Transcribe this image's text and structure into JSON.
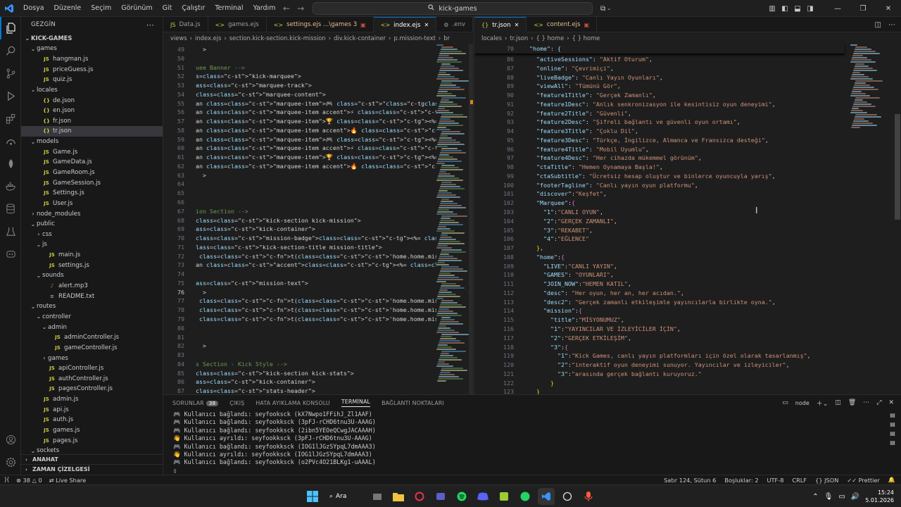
{
  "titlebar": {
    "menu": [
      "Dosya",
      "Düzenle",
      "Seçim",
      "Görünüm",
      "Git",
      "Çalıştır",
      "Terminal",
      "Yardım"
    ],
    "search": "kick-games"
  },
  "sidebar": {
    "title": "GEZGİN",
    "root": "KICK-GAMES",
    "items": [
      {
        "label": "games",
        "depth": 1,
        "type": "folder",
        "open": true
      },
      {
        "label": "hangman.js",
        "depth": 2,
        "type": "js"
      },
      {
        "label": "priceGuess.js",
        "depth": 2,
        "type": "js"
      },
      {
        "label": "quiz.js",
        "depth": 2,
        "type": "js"
      },
      {
        "label": "locales",
        "depth": 1,
        "type": "folder",
        "open": true
      },
      {
        "label": "de.json",
        "depth": 2,
        "type": "json"
      },
      {
        "label": "en.json",
        "depth": 2,
        "type": "json"
      },
      {
        "label": "fr.json",
        "depth": 2,
        "type": "json"
      },
      {
        "label": "tr.json",
        "depth": 2,
        "type": "json",
        "selected": true
      },
      {
        "label": "models",
        "depth": 1,
        "type": "folder",
        "open": true
      },
      {
        "label": "Game.js",
        "depth": 2,
        "type": "js"
      },
      {
        "label": "GameData.js",
        "depth": 2,
        "type": "js"
      },
      {
        "label": "GameRoom.js",
        "depth": 2,
        "type": "js"
      },
      {
        "label": "GameSession.js",
        "depth": 2,
        "type": "js"
      },
      {
        "label": "Settings.js",
        "depth": 2,
        "type": "js"
      },
      {
        "label": "User.js",
        "depth": 2,
        "type": "js"
      },
      {
        "label": "node_modules",
        "depth": 1,
        "type": "folder",
        "open": false
      },
      {
        "label": "public",
        "depth": 1,
        "type": "folder",
        "open": true
      },
      {
        "label": "css",
        "depth": 2,
        "type": "folder",
        "open": false
      },
      {
        "label": "js",
        "depth": 2,
        "type": "folder",
        "open": true
      },
      {
        "label": "main.js",
        "depth": 3,
        "type": "js"
      },
      {
        "label": "settings.js",
        "depth": 3,
        "type": "js"
      },
      {
        "label": "sounds",
        "depth": 2,
        "type": "folder",
        "open": true
      },
      {
        "label": "alert.mp3",
        "depth": 3,
        "type": "mp3"
      },
      {
        "label": "README.txt",
        "depth": 3,
        "type": "txt"
      },
      {
        "label": "routes",
        "depth": 1,
        "type": "folder",
        "open": true
      },
      {
        "label": "controller",
        "depth": 2,
        "type": "folder",
        "open": true
      },
      {
        "label": "admin",
        "depth": 3,
        "type": "folder",
        "open": true
      },
      {
        "label": "adminController.js",
        "depth": 4,
        "type": "js"
      },
      {
        "label": "gameController.js",
        "depth": 4,
        "type": "js"
      },
      {
        "label": "games",
        "depth": 3,
        "type": "folder",
        "open": false
      },
      {
        "label": "apiController.js",
        "depth": 3,
        "type": "js"
      },
      {
        "label": "authController.js",
        "depth": 3,
        "type": "js"
      },
      {
        "label": "pagesController.js",
        "depth": 3,
        "type": "js"
      },
      {
        "label": "admin.js",
        "depth": 2,
        "type": "js"
      },
      {
        "label": "api.js",
        "depth": 2,
        "type": "js"
      },
      {
        "label": "auth.js",
        "depth": 2,
        "type": "js"
      },
      {
        "label": "games.js",
        "depth": 2,
        "type": "js"
      },
      {
        "label": "pages.js",
        "depth": 2,
        "type": "js"
      },
      {
        "label": "sockets",
        "depth": 1,
        "type": "folder",
        "open": true
      }
    ],
    "outline": "ANAHAT",
    "timeline": "ZAMAN ÇİZELGESİ"
  },
  "editor1": {
    "tabs": [
      {
        "label": "Data.js",
        "type": "js"
      },
      {
        "label": "games.ejs",
        "type": "ejs"
      },
      {
        "label": "settings.ejs ...\\games 3",
        "type": "ejs",
        "modified": true
      },
      {
        "label": "index.ejs",
        "type": "ejs",
        "active": true
      },
      {
        "label": ".env",
        "type": "env"
      }
    ],
    "breadcrumb": [
      "views",
      "index.ejs",
      "section.kick-section.kick-mission",
      "div.kick-container",
      "p.mission-text",
      "br"
    ],
    "lines": [
      {
        "n": "49",
        "t": "  >"
      },
      {
        "n": "50",
        "t": ""
      },
      {
        "n": "51",
        "t": "uee Banner -->"
      },
      {
        "n": "52",
        "t": "s=\"kick-marquee\">"
      },
      {
        "n": "53",
        "t": "ass=\"marquee-track\">"
      },
      {
        "n": "54",
        "t": "class=\"marquee-content\">"
      },
      {
        "n": "55",
        "t": "an class=\"marquee-item\">🎮 \"<%= t('home.Marquee.1') %></span>"
      },
      {
        "n": "56",
        "t": "an class=\"marquee-item accent\">⚡ <%= t('home.Marquee.2') %></spa"
      },
      {
        "n": "57",
        "t": "an class=\"marquee-item\">🏆 <%= t('home.Marquee.3') %></span>"
      },
      {
        "n": "58",
        "t": "an class=\"marquee-item accent\">🔥 <%= t('home.Marquee.4') %></spa"
      },
      {
        "n": "59",
        "t": "an class=\"marquee-item\">🎮 <%= t('home.Marquee.1') %></span>"
      },
      {
        "n": "60",
        "t": "an class=\"marquee-item accent\">⚡ <%= t('home.Marquee.2') %></spa"
      },
      {
        "n": "61",
        "t": "an class=\"marquee-item\">🏆 <%= t('home.Marquee.3') %></span>"
      },
      {
        "n": "62",
        "t": "an class=\"marquee-item accent\">🔥 <%= t('home.Marquee.4') %></spa"
      },
      {
        "n": "63",
        "t": "  >"
      },
      {
        "n": "64",
        "t": ""
      },
      {
        "n": "65",
        "t": ""
      },
      {
        "n": "66",
        "t": ""
      },
      {
        "n": "67",
        "t": "ion Section -->"
      },
      {
        "n": "68",
        "t": "class=\"kick-section kick-mission\">"
      },
      {
        "n": "69",
        "t": "ass=\"kick-container\">"
      },
      {
        "n": "70",
        "t": "class=\"mission-badge\"><%= t('home.mission.title') %></div>"
      },
      {
        "n": "71",
        "t": "lass=\"kick-section-title mission-title\">"
      },
      {
        "n": "72",
        "t": " t('home.home.mission.1') %><br>"
      },
      {
        "n": "73",
        "t": "an class=\"accent\"><%= t('home.home.mission.2') %></span>"
      },
      {
        "n": "74",
        "t": ""
      },
      {
        "n": "75",
        "t": "ass=\"mission-text\">"
      },
      {
        "n": "76",
        "t": "  >"
      },
      {
        "n": "77",
        "t": " t('home.home.mission.3.1') %><br>"
      },
      {
        "n": "78",
        "t": " t('home.home.mission.3.2') %><br>"
      },
      {
        "n": "79",
        "t": " t('home.home.mission.3.3') %>"
      },
      {
        "n": "80",
        "t": ""
      },
      {
        "n": "81",
        "t": ""
      },
      {
        "n": "82",
        "t": "  >"
      },
      {
        "n": "83",
        "t": ""
      },
      {
        "n": "84",
        "t": "s Section - Kick Style -->"
      },
      {
        "n": "85",
        "t": "class=\"kick-section kick-stats\">"
      },
      {
        "n": "86",
        "t": "ass=\"kick-container\">"
      },
      {
        "n": "87",
        "t": "class=\"stats-header\">"
      }
    ]
  },
  "editor2": {
    "tabs": [
      {
        "label": "tr.json",
        "type": "json",
        "active": true
      },
      {
        "label": "content.ejs",
        "type": "ejs",
        "modified": true
      }
    ],
    "breadcrumb": [
      "locales",
      "tr.json",
      "{ } home",
      "{ } home"
    ],
    "sticky": {
      "n": "70",
      "t": "  \"home\": {"
    },
    "lines": [
      {
        "n": "86",
        "t": "    \"activeSessions\": \"Aktif Oturum\","
      },
      {
        "n": "87",
        "t": "    \"online\": \"Çevrimiçi\","
      },
      {
        "n": "88",
        "t": "    \"liveBadge\": \"Canlı Yayın Oyunları\","
      },
      {
        "n": "89",
        "t": "    \"viewAll\": \"Tümünü Gör\","
      },
      {
        "n": "90",
        "t": "    \"feature1Title\": \"Gerçek Zamanlı\","
      },
      {
        "n": "91",
        "t": "    \"feature1Desc\": \"Anlık senkronizasyon ile kesintisiz oyun deneyimi\","
      },
      {
        "n": "92",
        "t": "    \"feature2Title\": \"Güvenli\","
      },
      {
        "n": "93",
        "t": "    \"feature2Desc\": \"Şifreli bağlantı ve güvenli oyun ortamı\","
      },
      {
        "n": "94",
        "t": "    \"feature3Title\": \"Çoklu Dil\","
      },
      {
        "n": "95",
        "t": "    \"feature3Desc\": \"Türkçe, İngilizce, Almanca ve Fransızca desteği\","
      },
      {
        "n": "96",
        "t": "    \"feature4Title\": \"Mobil Uyumlu\","
      },
      {
        "n": "97",
        "t": "    \"feature4Desc\": \"Her cihazda mükemmel görünüm\","
      },
      {
        "n": "98",
        "t": "    \"ctaTitle\": \"Hemen Oynamaya Başla!\","
      },
      {
        "n": "99",
        "t": "    \"ctaSubtitle\": \"Ücretsiz hesap oluştur ve binlerce oyuncuyla yarış\","
      },
      {
        "n": "100",
        "t": "    \"footerTagline\": \"Canlı yayın oyun platformu\","
      },
      {
        "n": "101",
        "t": "    \"discover\":\"Keşfet\","
      },
      {
        "n": "102",
        "t": "    \"Marquee\":{"
      },
      {
        "n": "103",
        "t": "      \"1\":\"CANLI OYUN\","
      },
      {
        "n": "104",
        "t": "      \"2\":\"GERÇEK ZAMANLI\","
      },
      {
        "n": "105",
        "t": "      \"3\":\"REKABET\","
      },
      {
        "n": "106",
        "t": "      \"4\":\"EĞLENCE\""
      },
      {
        "n": "107",
        "t": "    },"
      },
      {
        "n": "108",
        "t": "    \"home\":{"
      },
      {
        "n": "109",
        "t": "      \"LIVE\":\"CANLI YAYIN\","
      },
      {
        "n": "110",
        "t": "      \"GAMES\": \"OYUNLARI\","
      },
      {
        "n": "111",
        "t": "      \"JOIN_NOW\":\"HEMEN KATIL\","
      },
      {
        "n": "112",
        "t": "      \"desc\": \"Her oyun, her an, her acıdan.\","
      },
      {
        "n": "113",
        "t": "      \"desc2\": \"Gerçek zamanlı etkileşimle yayıncılarla birlikte oyna.\","
      },
      {
        "n": "114",
        "t": "      \"mission\":{"
      },
      {
        "n": "115",
        "t": "        \"title\":\"MİSYONUMUZ\","
      },
      {
        "n": "116",
        "t": "        \"1\":\"YAYINCILAR VE İZLEYİCİLER İÇİN\","
      },
      {
        "n": "117",
        "t": "        \"2\":\"GERÇEK ETKİLEŞİM\","
      },
      {
        "n": "118",
        "t": "        \"3\":{"
      },
      {
        "n": "119",
        "t": "          \"1\":\"Kick Games, canlı yayın platformları için özel olarak tasarlanmış\","
      },
      {
        "n": "120",
        "t": "          \"2\":\"interaktif oyun deneyimi sunuyor. Yayıncılar ve izleyiciler\","
      },
      {
        "n": "121",
        "t": "          \"3\":\"arasında gerçek bağlantı kuruyoruz.\""
      },
      {
        "n": "122",
        "t": "        }"
      },
      {
        "n": "123",
        "t": "    }"
      }
    ]
  },
  "panel": {
    "tabs": [
      {
        "label": "SORUNLAR",
        "count": "38"
      },
      {
        "label": "ÇIKIŞ"
      },
      {
        "label": "HATA AYIKLAMA KONSOLU"
      },
      {
        "label": "TERMİNAL",
        "active": true
      },
      {
        "label": "BAĞLANTI NOKTALARI"
      }
    ],
    "shell": "node",
    "lines": [
      "🎮 Kullanıcı bağlandı: seyfooksck (kX7Nwpo1FFihJ_Zl1AAF)",
      "🎮 Kullanıcı bağlandı: seyfookksck (3pFJ-rCHD6tnu3U-AAAG)",
      "🎮 Kullanıcı bağlandı: seyfookksck (2ibn5YEOeQCwgJACAAAH)",
      "👋 Kullanıcı ayrıldı: seyfookksck (3pFJ-rCHD6tnu3U-AAAG)",
      "🎮 Kullanıcı bağlandı: seyfookksck (IOG1lJGzSYpqL7dmAAA3)",
      "👋 Kullanıcı ayrıldı: seyfookksck (IOG1lJGzSYpqL7dmAAA3)",
      "🎮 Kullanıcı bağlandı: seyfookksck (o2PVc4O21BLKg1-uAAAL)"
    ]
  },
  "statusbar": {
    "errors": "38",
    "warnings": "0",
    "liveshare": "Live Share",
    "position": "Satır 124, Sütun 6",
    "spaces": "Boşluklar: 2",
    "encoding": "UTF-8",
    "eol": "CRLF",
    "language": "JSON",
    "prettier": "Prettier"
  },
  "taskbar": {
    "search": "Ara",
    "time": "15:24",
    "date": "5.01.2026"
  },
  "colors": {
    "accent": "#0078d4",
    "editor_bg": "#1e1e1e",
    "sidebar_bg": "#181818"
  }
}
